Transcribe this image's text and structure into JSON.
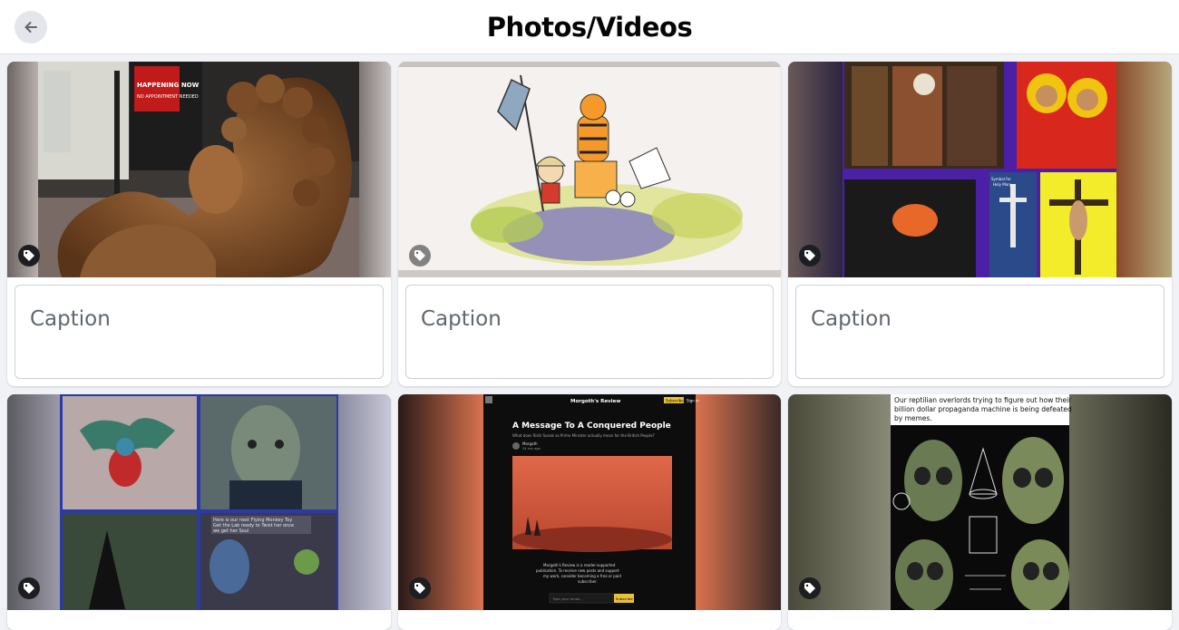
{
  "header": {
    "title": "Photos/Videos"
  },
  "cards": [
    {
      "caption_placeholder": "Caption"
    },
    {
      "caption_placeholder": "Caption"
    },
    {
      "caption_placeholder": "Caption"
    }
  ],
  "media": {
    "lion": {
      "storefront_text_1": "HAPPENING NOW",
      "storefront_text_2": "NO APPOINTMENT NEEDED"
    },
    "collage": {
      "cross_caption_1": "Symbol for",
      "cross_caption_2": "Holy Mary"
    },
    "monkey": {
      "meme_line_1": "Here is our next Flying Monkey Toy",
      "meme_line_2": "Get the Lab ready to Twist her once",
      "meme_line_3": "we get her Soul"
    },
    "substack": {
      "site_name": "Morgoth's Review",
      "subscribe": "Subscribe",
      "sign_in": "Sign in",
      "headline": "A Message To A Conquered People",
      "subhead": "What does Rishi Sunak as Prime Minister actually mean for the British People?",
      "author": "Morgoth",
      "date": "24 min ago",
      "blurb_1": "Morgoth's Review is a reader-supported",
      "blurb_2": "publication. To receive new posts and support",
      "blurb_3": "my work, consider becoming a free or paid",
      "blurb_4": "subscriber.",
      "email_placeholder": "Type your email...",
      "subscribe_btn": "Subscribe"
    },
    "reptilian": {
      "meme_line_1": "Our reptilian overlords trying to figure out how their",
      "meme_line_2": "billion dollar propaganda machine is being defeated",
      "meme_line_3": "by memes."
    }
  },
  "colors": {
    "header_bg": "#ffffff",
    "page_bg": "#f0f2f5",
    "title": "#050505",
    "caption_text": "#606770"
  }
}
